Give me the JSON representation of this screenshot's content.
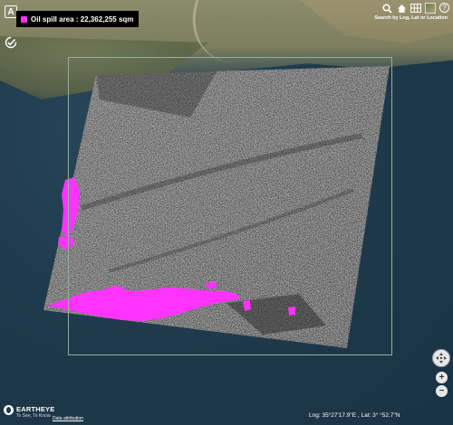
{
  "legend": {
    "label": "Oil spill area : 22,362,255 sqm",
    "color": "#ff33ff"
  },
  "toolbar": {
    "search_caption": "Search by Lng, Lat or Location",
    "icons": [
      "search-icon",
      "home-icon",
      "grid-icon",
      "layer-thumbnail-icon",
      "help-icon"
    ],
    "help_label": "?"
  },
  "left_tools": {
    "area_tool_label": "A",
    "check_tool_icon": "check-icon"
  },
  "brand": {
    "name": "EARTHEYE",
    "tagline": "To See, To Know.",
    "attribution": "Data attribution"
  },
  "coords": {
    "text": "Lng: 35°27'17.9\"E , Lat: 3°   °52.7\"N"
  },
  "zoom": {
    "in_label": "+",
    "out_label": "−"
  },
  "colors": {
    "sea": "#1f3a4c",
    "spill": "#ff33ff",
    "frame": "#8fb39a"
  }
}
